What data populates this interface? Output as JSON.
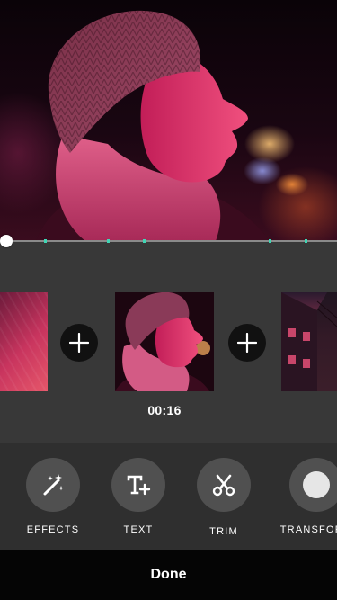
{
  "preview": {
    "subject": "woman in knit beanie at night",
    "tint_color": "#e0306a"
  },
  "timeline": {
    "playhead_position": 0,
    "marker_color": "#3fd7b5"
  },
  "clips": {
    "items": [
      {
        "name": "clip-previous",
        "selected": false
      },
      {
        "name": "clip-current",
        "selected": true
      },
      {
        "name": "clip-next",
        "selected": false
      }
    ],
    "add_icon": "plus-icon",
    "current_duration": "00:16"
  },
  "tools": {
    "items": [
      {
        "id": "effects",
        "label": "EFFECTS",
        "icon": "magic-wand-icon"
      },
      {
        "id": "text",
        "label": "TEXT",
        "icon": "text-plus-icon"
      },
      {
        "id": "trim",
        "label": "TRIM",
        "icon": "scissors-icon"
      },
      {
        "id": "transform",
        "label": "TRANSFORM",
        "icon": "circle-icon"
      }
    ]
  },
  "footer": {
    "done_label": "Done"
  },
  "colors": {
    "background": "#383838",
    "tool_button": "#505050",
    "done_bar": "#050505",
    "accent": "#3fd7b5"
  }
}
